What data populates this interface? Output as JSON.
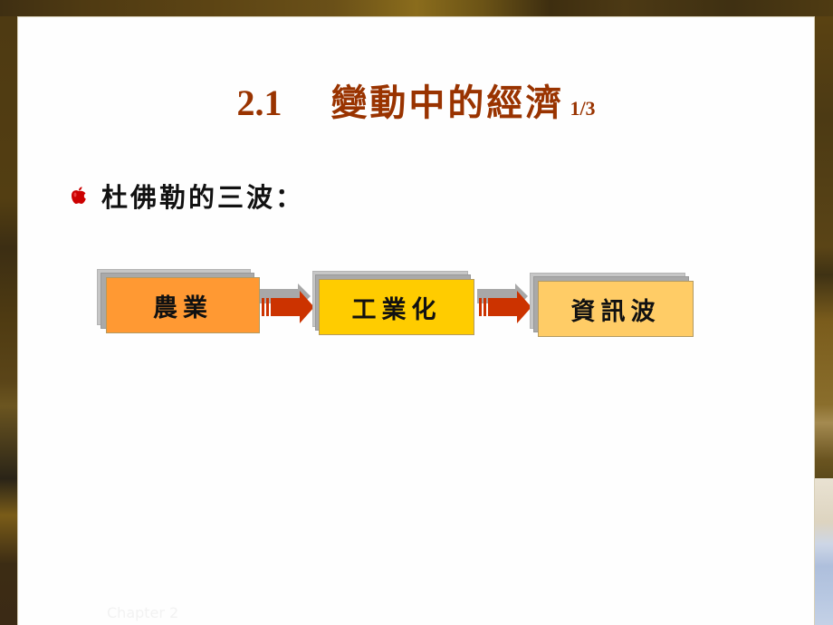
{
  "slide": {
    "title": {
      "number": "2.1",
      "text": "變動中的經濟",
      "page_indicator": "1/3"
    },
    "bullet": {
      "icon": "apple-icon",
      "text": "杜佛勒的三波："
    },
    "flow": {
      "steps": [
        {
          "label": "農業",
          "color": "#ff9933"
        },
        {
          "label": "工業化",
          "color": "#ffcc00"
        },
        {
          "label": "資訊波",
          "color": "#ffcc66"
        }
      ],
      "arrow_color": "#cc3300"
    },
    "footer": "Chapter 2",
    "colors": {
      "title": "#993300",
      "bullet_icon": "#cc0000"
    }
  }
}
